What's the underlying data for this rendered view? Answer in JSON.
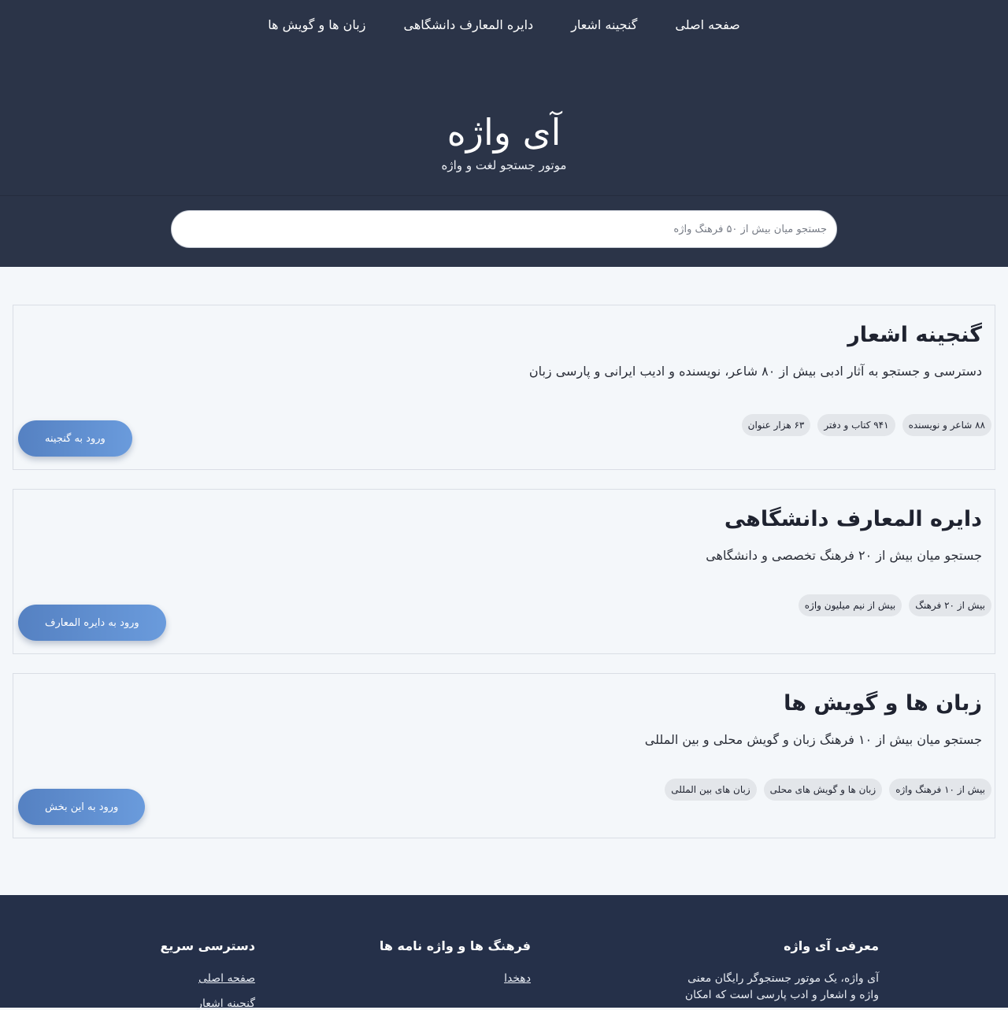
{
  "nav": {
    "items": [
      "صفحه اصلی",
      "گنجینه اشعار",
      "دایره المعارف دانشگاهی",
      "زبان ها و گویش ها"
    ]
  },
  "brand": {
    "title": "آی واژه",
    "subtitle": "موتور جستجو لغت و واژه"
  },
  "search": {
    "placeholder": "جستجو میان بیش از ۵۰ فرهنگ واژه",
    "value": ""
  },
  "sections": [
    {
      "title": "گنجینه اشعار",
      "description": "دسترسی و جستجو به آثار ادبی بیش از ۸۰ شاعر، نویسنده و ادیب ایرانی و پارسی زبان",
      "tags": [
        "۸۸ شاعر و نویسنده",
        "۹۴۱ کتاب و دفتر",
        "۶۳ هزار عنوان"
      ],
      "button": "ورود به گنجینه"
    },
    {
      "title": "دایره المعارف دانشگاهی",
      "description": "جستجو میان بیش از ۲۰ فرهنگ تخصصی و دانشگاهی",
      "tags": [
        "بیش از ۲۰ فرهنگ",
        "بیش از نیم میلیون واژه"
      ],
      "button": "ورود به دایره المعارف"
    },
    {
      "title": "زبان ها و گویش ها",
      "description": "جستجو میان بیش از ۱۰ فرهنگ زبان و گویش محلی و بین المللی",
      "tags": [
        "بیش از ۱۰ فرهنگ واژه",
        "زبان ها و گویش های محلی",
        "زبان های بین المللی"
      ],
      "button": "ورود به این بخش"
    }
  ],
  "footer": {
    "about": {
      "title": "معرفی آی واژه",
      "text": "آی واژه، یک موتور جستجوگر رایگان معنی واژه و اشعار و ادب پارسی است که امکان"
    },
    "dictionaries": {
      "title": "فرهنگ ها و واژه نامه ها",
      "links": [
        "دهخدا"
      ]
    },
    "quick": {
      "title": "دسترسی سریع",
      "links": [
        "صفحه اصلی",
        "گنجینه اشعار"
      ]
    }
  },
  "colors": {
    "header_bg": "#2b3448",
    "footer_bg": "#253049",
    "page_bg": "#f4f7fa",
    "button_start": "#5581c2",
    "button_end": "#6a9bdc",
    "tag_bg": "#e3e6ea"
  }
}
